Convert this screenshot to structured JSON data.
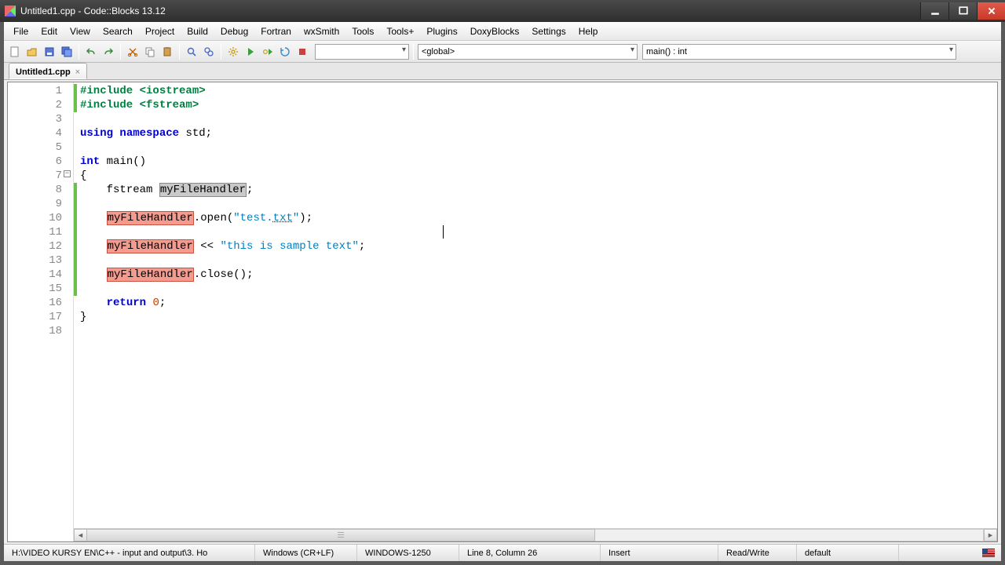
{
  "window": {
    "title": "Untitled1.cpp - Code::Blocks 13.12"
  },
  "menu": {
    "items": [
      "File",
      "Edit",
      "View",
      "Search",
      "Project",
      "Build",
      "Debug",
      "Fortran",
      "wxSmith",
      "Tools",
      "Tools+",
      "Plugins",
      "DoxyBlocks",
      "Settings",
      "Help"
    ]
  },
  "toolbar": {
    "scope_combo": "<global>",
    "symbol_combo": "main() : int"
  },
  "tab": {
    "label": "Untitled1.cpp"
  },
  "code": {
    "lines": [
      {
        "n": 1,
        "mk": true
      },
      {
        "n": 2,
        "mk": true
      },
      {
        "n": 3
      },
      {
        "n": 4
      },
      {
        "n": 5
      },
      {
        "n": 6
      },
      {
        "n": 7
      },
      {
        "n": 8,
        "mk": true
      },
      {
        "n": 9,
        "mk": true
      },
      {
        "n": 10,
        "mk": true
      },
      {
        "n": 11,
        "mk": true
      },
      {
        "n": 12,
        "mk": true
      },
      {
        "n": 13,
        "mk": true
      },
      {
        "n": 14,
        "mk": true
      },
      {
        "n": 15,
        "mk": true
      },
      {
        "n": 16
      },
      {
        "n": 17
      },
      {
        "n": 18
      }
    ],
    "tok": {
      "include": "#include",
      "iostream": "<iostream>",
      "fstream_hdr": "<fstream>",
      "using": "using",
      "namespace": "namespace",
      "std": "std",
      "int": "int",
      "main": "main",
      "fstream": "fstream",
      "myfh": "myFileHandler",
      "open": "open",
      "test_txt": "\"test.",
      "txt": "txt",
      "txt_close": "\"",
      "shl": "<<",
      "sample": "\"this is sample text\"",
      "close": "close",
      "ret": "return",
      "zero": "0",
      "lbrace": "{",
      "rbrace": "}",
      "lp": "(",
      "rp": ")",
      "semi": ";",
      "dot": "."
    }
  },
  "status": {
    "path": "H:\\VIDEO KURSY EN\\C++ - input and output\\3. Ho",
    "eol": "Windows (CR+LF)",
    "enc": "WINDOWS-1250",
    "pos": "Line 8, Column 26",
    "ins": "Insert",
    "rw": "Read/Write",
    "prof": "default"
  }
}
